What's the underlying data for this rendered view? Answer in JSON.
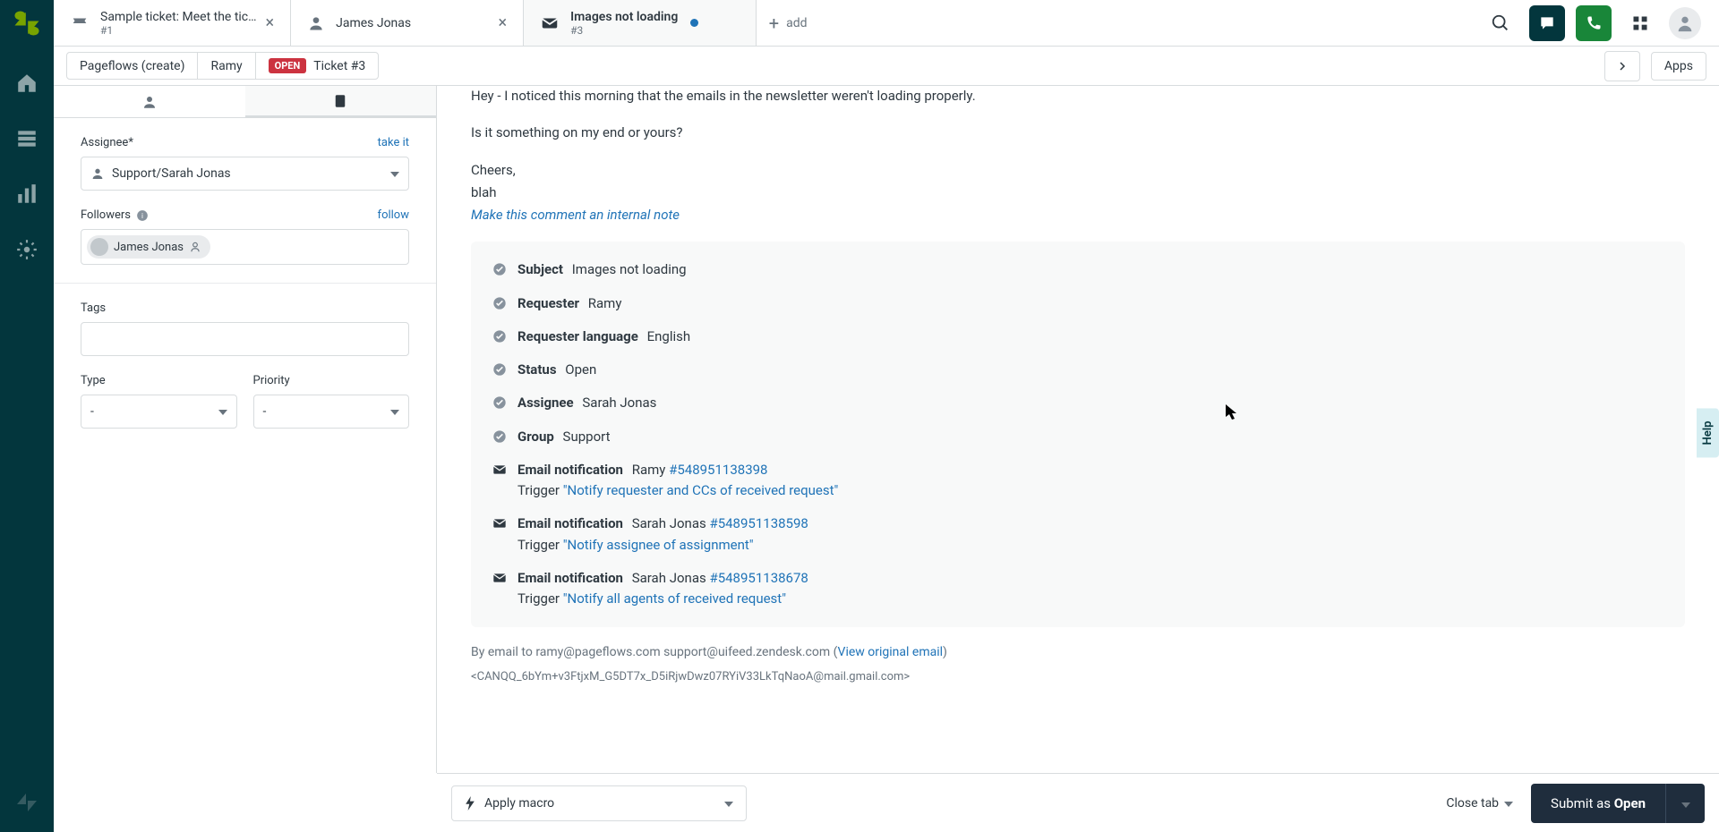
{
  "tabs": [
    {
      "title": "Sample ticket: Meet the tic…",
      "sub": "#1",
      "icon": "ticket"
    },
    {
      "title": "James Jonas",
      "sub": "",
      "icon": "user"
    },
    {
      "title": "Images not loading",
      "sub": "#3",
      "icon": "mail",
      "unread": true
    }
  ],
  "add_tab_label": "add",
  "breadcrumbs": {
    "org": "Pageflows (create)",
    "requester": "Ramy",
    "status_badge": "OPEN",
    "ticket_ref": "Ticket #3",
    "apps_label": "Apps"
  },
  "sidebar": {
    "assignee_label": "Assignee*",
    "take_it": "take it",
    "assignee_value": "Support/Sarah Jonas",
    "followers_label": "Followers",
    "follow_link": "follow",
    "followers": [
      {
        "name": "James Jonas"
      }
    ],
    "tags_label": "Tags",
    "type_label": "Type",
    "type_value": "-",
    "priority_label": "Priority",
    "priority_value": "-"
  },
  "message": {
    "line1": "Hey - I noticed this morning that the emails in the newsletter weren't loading properly.",
    "line2": "Is it something on my end or yours?",
    "sig1": "Cheers,",
    "sig2": "blah",
    "internal_note_link": "Make this comment an internal note"
  },
  "events": [
    {
      "kind": "check",
      "label": "Subject",
      "value": "Images not loading"
    },
    {
      "kind": "check",
      "label": "Requester",
      "value": "Ramy"
    },
    {
      "kind": "check",
      "label": "Requester language",
      "value": "English"
    },
    {
      "kind": "check",
      "label": "Status",
      "value": "Open"
    },
    {
      "kind": "check",
      "label": "Assignee",
      "value": "Sarah Jonas"
    },
    {
      "kind": "check",
      "label": "Group",
      "value": "Support"
    },
    {
      "kind": "mail",
      "label": "Email notification",
      "value": "Ramy",
      "link": "#548951138398",
      "trigger_prefix": "Trigger ",
      "trigger_link": "\"Notify requester and CCs of received request\""
    },
    {
      "kind": "mail",
      "label": "Email notification",
      "value": "Sarah Jonas",
      "link": "#548951138598",
      "trigger_prefix": "Trigger ",
      "trigger_link": "\"Notify assignee of assignment\""
    },
    {
      "kind": "mail",
      "label": "Email notification",
      "value": "Sarah Jonas",
      "link": "#548951138678",
      "trigger_prefix": "Trigger ",
      "trigger_link": "\"Notify all agents of received request\""
    }
  ],
  "meta": {
    "prefix": "By email to ramy@pageflows.com support@uifeed.zendesk.com (",
    "link": "View original email",
    "suffix": ")",
    "raw": "<CANQQ_6bYm+v3FtjxM_G5DT7x_D5iRjwDwz07RYiV33LkTqNaoA@mail.gmail.com>"
  },
  "footer": {
    "macro_label": "Apply macro",
    "close_tab_label": "Close tab",
    "submit_prefix": "Submit as ",
    "submit_status": "Open"
  },
  "help_label": "Help"
}
